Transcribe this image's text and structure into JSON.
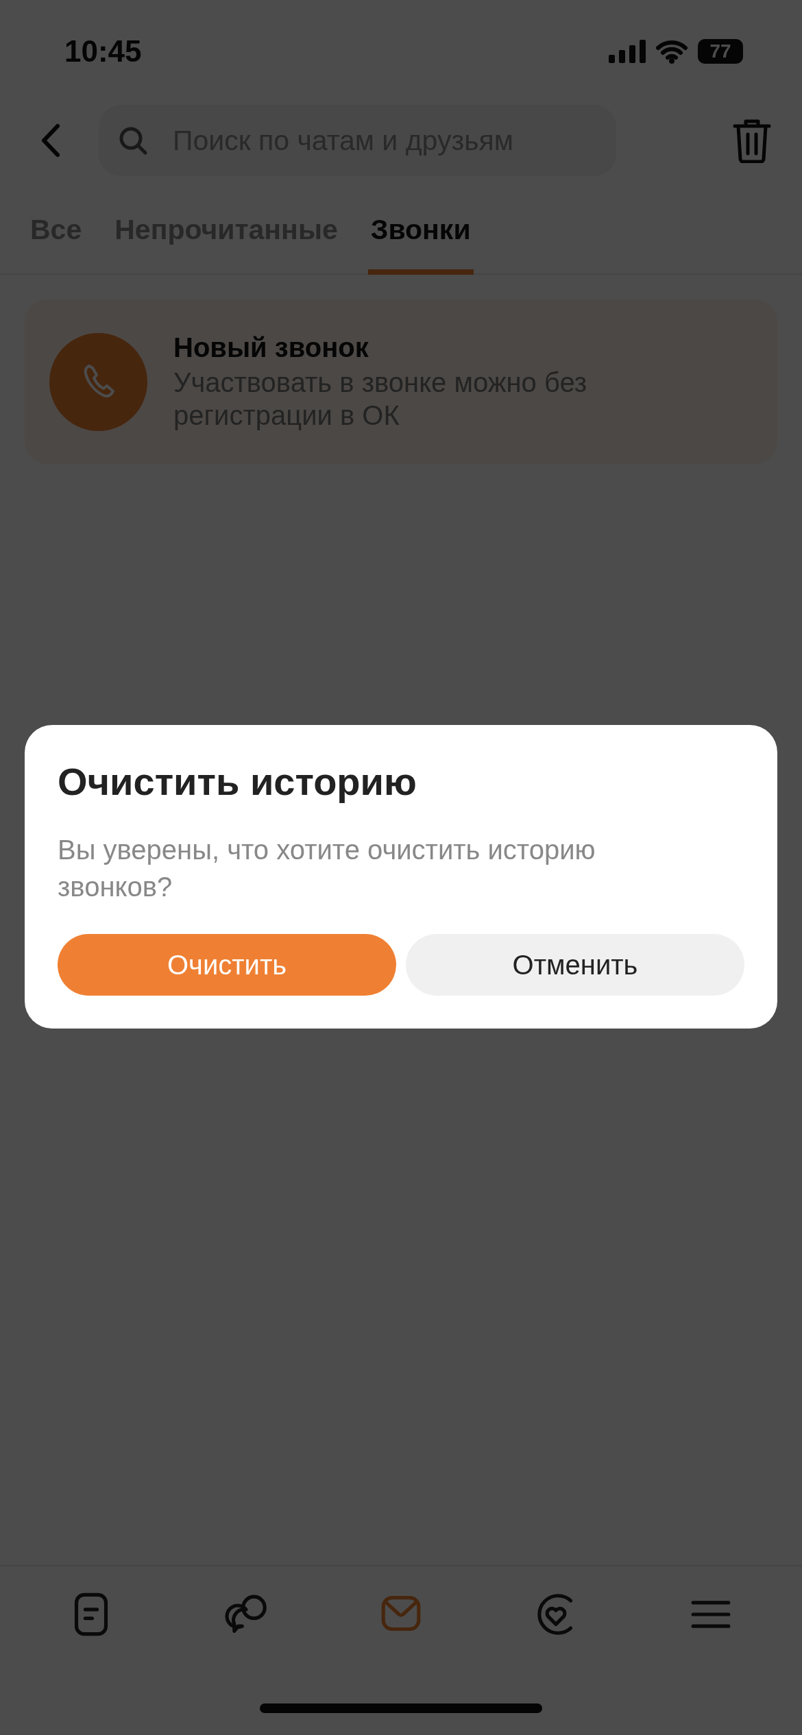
{
  "status_bar": {
    "time": "10:45",
    "battery": "77"
  },
  "search": {
    "placeholder": "Поиск по чатам и друзьям"
  },
  "tabs": [
    {
      "label": "Все",
      "selected": false
    },
    {
      "label": "Непрочитанные",
      "selected": false
    },
    {
      "label": "Звонки",
      "selected": true
    }
  ],
  "new_call_card": {
    "title": "Новый звонок",
    "subtitle": "Участвовать в звонке можно без регистрации в ОК"
  },
  "dialog": {
    "title": "Очистить историю",
    "message": "Вы уверены, что хотите очистить историю звонков?",
    "buttons": [
      {
        "label": "Очистить",
        "kind": "primary"
      },
      {
        "label": "Отменить",
        "kind": "secondary"
      }
    ]
  },
  "bottom_nav": [
    {
      "kind": "feed",
      "selected": false
    },
    {
      "kind": "chats",
      "selected": false
    },
    {
      "kind": "messages",
      "selected": true
    },
    {
      "kind": "discover",
      "selected": false
    },
    {
      "kind": "menu",
      "selected": false
    }
  ]
}
